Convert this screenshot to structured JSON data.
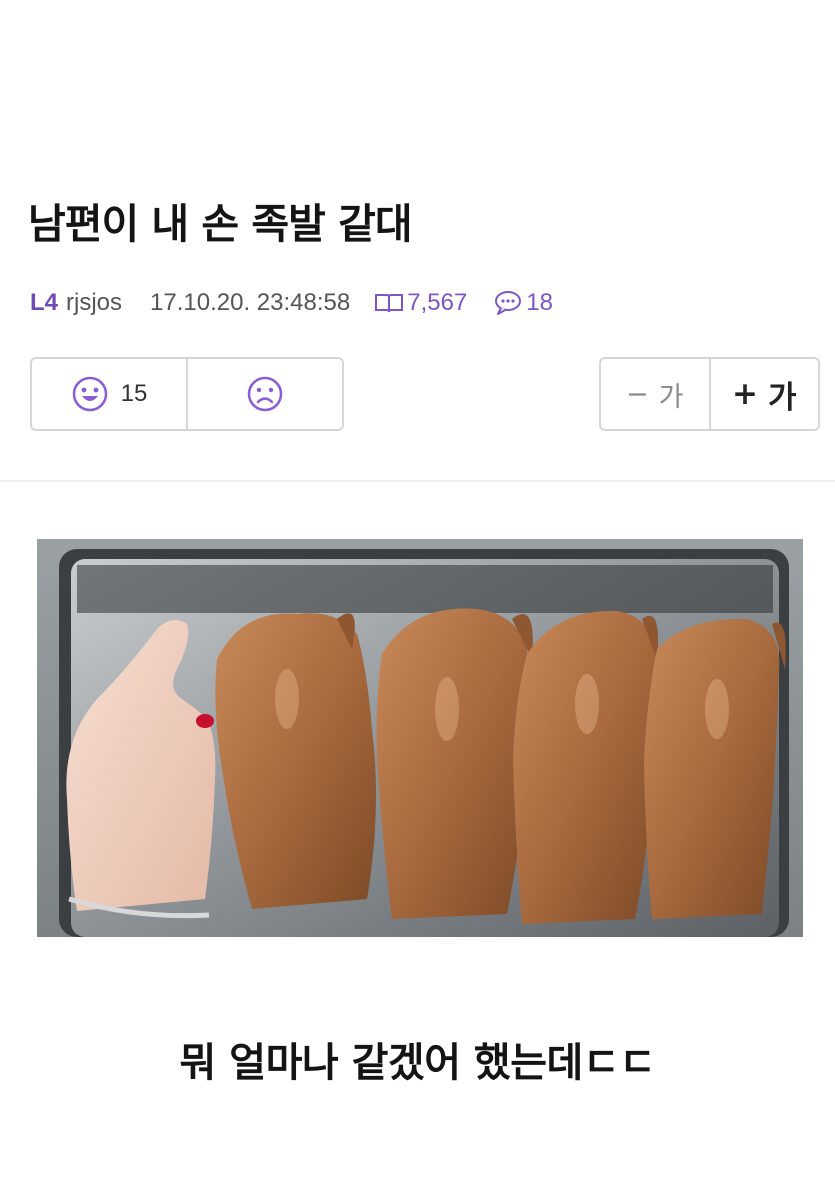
{
  "post": {
    "title": "남편이 내 손 족발 같대",
    "level": "L4",
    "author": "rjsjos",
    "datetime": "17.10.20. 23:48:58",
    "views": "7,567",
    "comments": "18"
  },
  "votes": {
    "like_count": "15",
    "like_icon": "smile-face-icon",
    "dislike_icon": "frown-face-icon"
  },
  "font_size": {
    "decrease_symbol": "−",
    "increase_symbol": "+",
    "label": "가"
  },
  "body": {
    "image_icon": "photo-hand-and-pig-trotters",
    "caption": "뭐 얼마나 같겠어 했는데ㄷㄷ"
  },
  "colors": {
    "accent": "#7d54c9",
    "level": "#6f4ab5",
    "border": "#d6d6d6"
  }
}
